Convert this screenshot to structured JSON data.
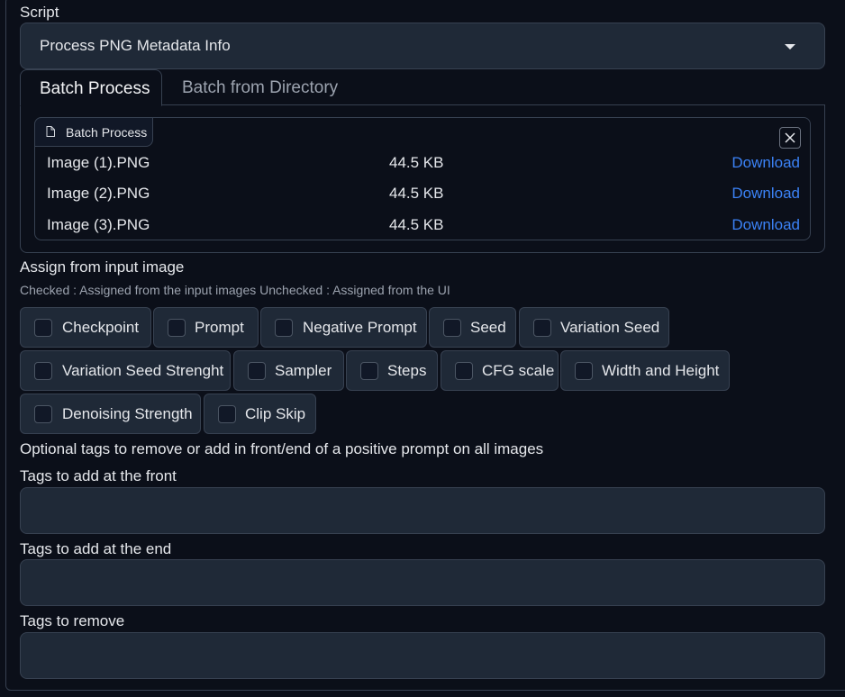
{
  "script": {
    "label": "Script",
    "selected": "Process PNG Metadata Info"
  },
  "tabs": [
    {
      "label": "Batch Process",
      "active": true
    },
    {
      "label": "Batch from Directory",
      "active": false
    }
  ],
  "files": {
    "badge": "Batch Process",
    "rows": [
      {
        "name": "Image (1).PNG",
        "size": "44.5 KB",
        "action": "Download"
      },
      {
        "name": "Image (2).PNG",
        "size": "44.5 KB",
        "action": "Download"
      },
      {
        "name": "Image (3).PNG",
        "size": "44.5 KB",
        "action": "Download"
      }
    ]
  },
  "assign": {
    "title": "Assign from input image",
    "hint": "Checked : Assigned from the input images Unchecked : Assigned from the UI",
    "options": [
      {
        "label": "Checkpoint",
        "checked": false
      },
      {
        "label": "Prompt",
        "checked": false
      },
      {
        "label": "Negative Prompt",
        "checked": false
      },
      {
        "label": "Seed",
        "checked": false
      },
      {
        "label": "Variation Seed",
        "checked": false
      },
      {
        "label": "Variation Seed Strenght",
        "checked": false
      },
      {
        "label": "Sampler",
        "checked": false
      },
      {
        "label": "Steps",
        "checked": false
      },
      {
        "label": "CFG scale",
        "checked": false
      },
      {
        "label": "Width and Height",
        "checked": false
      },
      {
        "label": "Denoising Strength",
        "checked": false
      },
      {
        "label": "Clip Skip",
        "checked": false
      }
    ]
  },
  "tags": {
    "title": "Optional tags to remove or add in front/end of a positive prompt on all images",
    "front_label": "Tags to add at the front",
    "front_value": "",
    "end_label": "Tags to add at the end",
    "end_value": "",
    "remove_label": "Tags to remove",
    "remove_value": ""
  },
  "colors": {
    "background": "#0b0f19",
    "panel": "#1f2937",
    "border": "#374151",
    "link": "#3b82f6"
  }
}
